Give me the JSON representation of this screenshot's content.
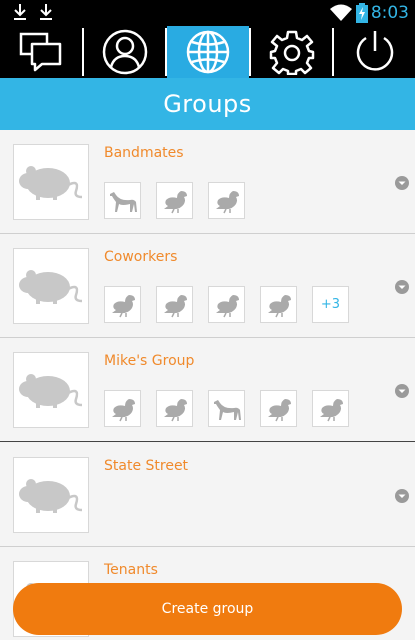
{
  "status_bar": {
    "time": "8:03"
  },
  "tabs": [
    {
      "icon": "chat-bubbles-icon",
      "active": false
    },
    {
      "icon": "profile-icon",
      "active": false
    },
    {
      "icon": "globe-icon",
      "active": true
    },
    {
      "icon": "gear-icon",
      "active": false
    },
    {
      "icon": "power-icon",
      "active": false
    }
  ],
  "header": {
    "title": "Groups"
  },
  "groups": [
    {
      "name": "Bandmates",
      "members": [
        "greyhound",
        "bird",
        "bird"
      ],
      "more": ""
    },
    {
      "name": "Coworkers",
      "members": [
        "bird",
        "bird",
        "bird",
        "bird"
      ],
      "more": "+3"
    },
    {
      "name": "Mike's Group",
      "members": [
        "bird",
        "bird",
        "greyhound",
        "bird",
        "bird"
      ],
      "more": ""
    },
    {
      "name": "State Street",
      "members": [],
      "more": ""
    },
    {
      "name": "Tenants",
      "members": [],
      "more": ""
    }
  ],
  "actions": {
    "create_label": "Create group"
  },
  "colors": {
    "accent_blue": "#33b5e5",
    "orange": "#f07b0f",
    "name_orange": "#f08a2c"
  }
}
